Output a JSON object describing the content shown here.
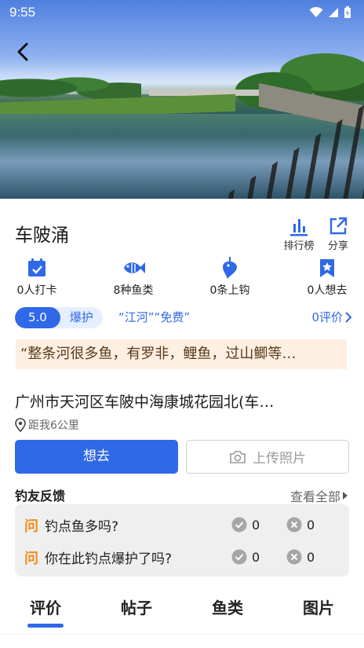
{
  "status_bar": {
    "time": "9:55"
  },
  "place": {
    "title": "车陂涌"
  },
  "toolbar": {
    "rank_label": "排行榜",
    "share_label": "分享"
  },
  "stats": [
    {
      "label": "0人打卡",
      "icon": "calendar-check-icon"
    },
    {
      "label": "8种鱼类",
      "icon": "fish-icon"
    },
    {
      "label": "0条上钩",
      "icon": "hooked-fish-icon"
    },
    {
      "label": "0人想去",
      "icon": "star-bookmark-icon"
    }
  ],
  "rating": {
    "score": "5.0",
    "tag": "爆护",
    "quote_tags": "“江河”“免费”",
    "review_link": "0评价"
  },
  "quote": "“整条河很多鱼，有罗非，鲤鱼，过山鲫等…",
  "address": {
    "text": "广州市天河区车陂中海康城花园北(车…",
    "distance": "距我6公里"
  },
  "actions": {
    "want_label": "想去",
    "upload_label": "上传照片"
  },
  "feedback": {
    "title": "钓友反馈",
    "more": "查看全部",
    "q_mark": "问",
    "items": [
      {
        "question": "钓点鱼多吗?",
        "yes": "0",
        "no": "0"
      },
      {
        "question": "你在此钓点爆护了吗?",
        "yes": "0",
        "no": "0"
      }
    ]
  },
  "tabs": [
    "评价",
    "帖子",
    "鱼类",
    "图片"
  ],
  "colors": {
    "accent": "#2f69e8",
    "quote_bg": "#fdefe2",
    "question_mark": "#f08a1c"
  }
}
